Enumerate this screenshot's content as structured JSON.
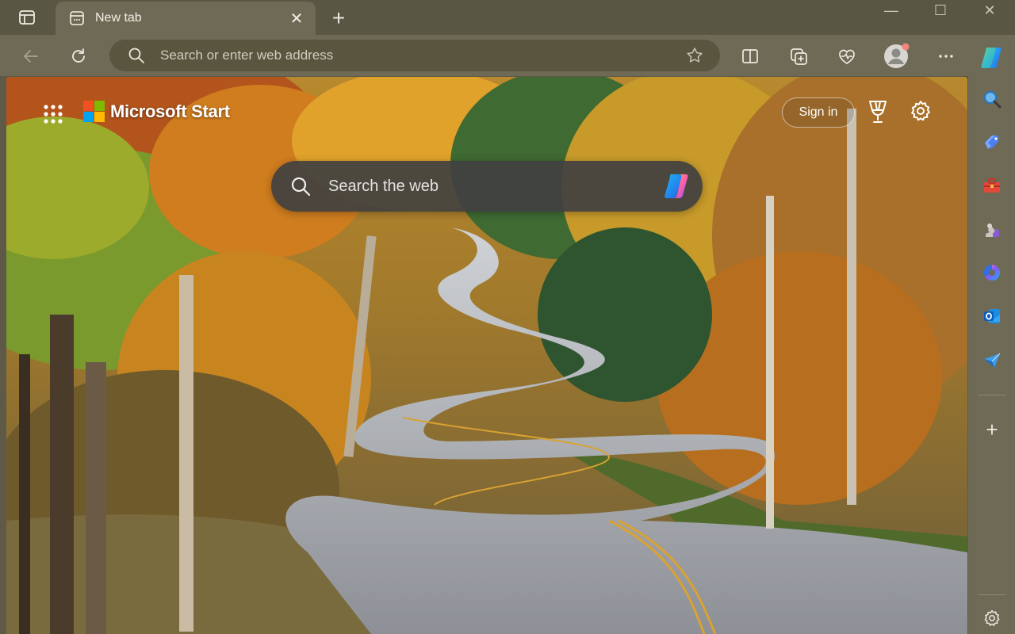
{
  "tab": {
    "title": "New tab",
    "close_symbol": "✕"
  },
  "toolbar": {
    "new_tab_symbol": "+"
  },
  "address_bar": {
    "placeholder": "Search or enter web address",
    "value": ""
  },
  "window_controls": {
    "minimize": "—",
    "maximize": "☐",
    "close": "✕"
  },
  "new_tab_page": {
    "brand": "Microsoft Start",
    "sign_in_label": "Sign in",
    "search_placeholder": "Search the web"
  },
  "sidebar": {
    "add_symbol": "+"
  },
  "colors": {
    "tab_strip": "#5a5644",
    "toolbar": "#6e6a56",
    "address_bar": "#59553f",
    "ms_red": "#f25022",
    "ms_green": "#7fba00",
    "ms_blue": "#00a4ef",
    "ms_yellow": "#ffb900"
  },
  "icons": [
    "tab-actions-icon",
    "new-tab-page-icon",
    "close-icon",
    "plus-icon",
    "back-arrow-icon",
    "refresh-icon",
    "search-icon",
    "star-icon",
    "split-screen-icon",
    "collections-icon",
    "browser-essentials-icon",
    "profile-avatar-icon",
    "more-icon",
    "copilot-icon",
    "apps-grid-icon",
    "microsoft-logo",
    "trophy-icon",
    "gear-icon",
    "shopping-tag-icon",
    "toolbox-icon",
    "games-icon",
    "microsoft-365-icon",
    "outlook-icon",
    "send-icon"
  ]
}
